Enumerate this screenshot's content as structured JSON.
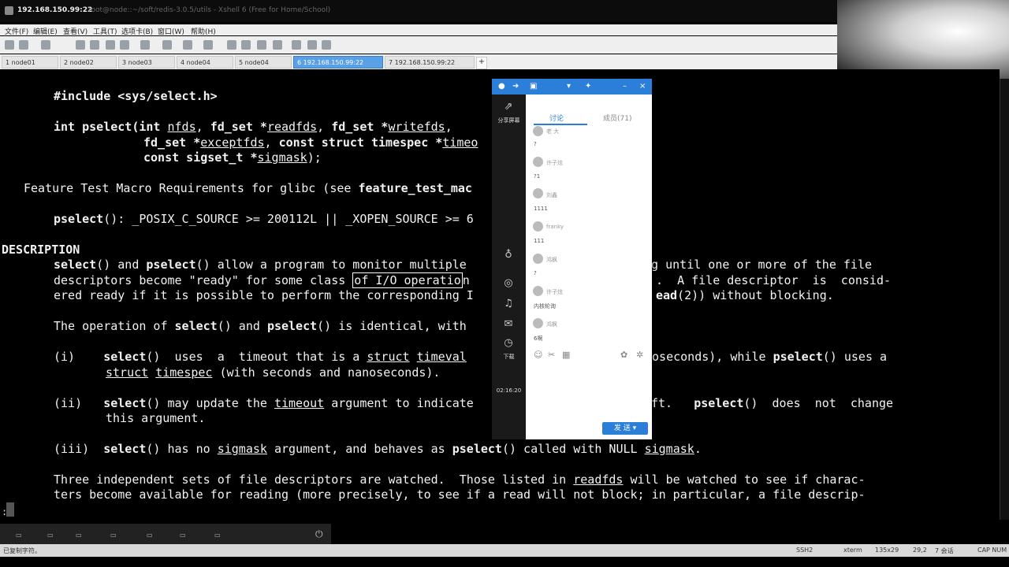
{
  "window": {
    "host": "192.168.150.99:22",
    "path": "root@node::~/soft/redis-3.0.5/utils - Xshell 6 (Free for Home/School)"
  },
  "menu": [
    "文件(F)",
    "编辑(E)",
    "查看(V)",
    "工具(T)",
    "选项卡(B)",
    "窗口(W)",
    "帮助(H)"
  ],
  "tabs": [
    {
      "label": "1 node01",
      "active": false
    },
    {
      "label": "2 node02",
      "active": false
    },
    {
      "label": "3 node03",
      "active": false
    },
    {
      "label": "4 node04",
      "active": false
    },
    {
      "label": "5 node04",
      "active": false
    },
    {
      "label": "6 192.168.150.99:22",
      "active": true
    },
    {
      "label": "7 192.168.150.99:22",
      "active": false
    }
  ],
  "add_tab": "+",
  "man": {
    "include": "#include <sys/select.h>",
    "desc_header": "DESCRIPTION"
  },
  "chat": {
    "tab_discuss": "讨论",
    "tab_members": "成员(71)",
    "left_share": "分享屏幕",
    "left_time": "02:16:20",
    "left_dl": "下载",
    "messages": [
      {
        "name": "老 大",
        "text": "?"
      },
      {
        "name": "许子炫",
        "text": "?1"
      },
      {
        "name": "刘鑫",
        "text": "1111"
      },
      {
        "name": "franky",
        "text": "111"
      },
      {
        "name": "鸿枫",
        "text": "?"
      },
      {
        "name": "许子炫",
        "text": "内核轮询"
      },
      {
        "name": "鸿枫",
        "text": "6啊"
      }
    ],
    "send": "发 送"
  },
  "status": {
    "left": "已复制字符。",
    "ssh": "SSH2",
    "term": "xterm",
    "size": "135x29",
    "pos": "29,2",
    "sessions": "7 会话",
    "caps": "CAP NUM"
  },
  "prompt": ":"
}
